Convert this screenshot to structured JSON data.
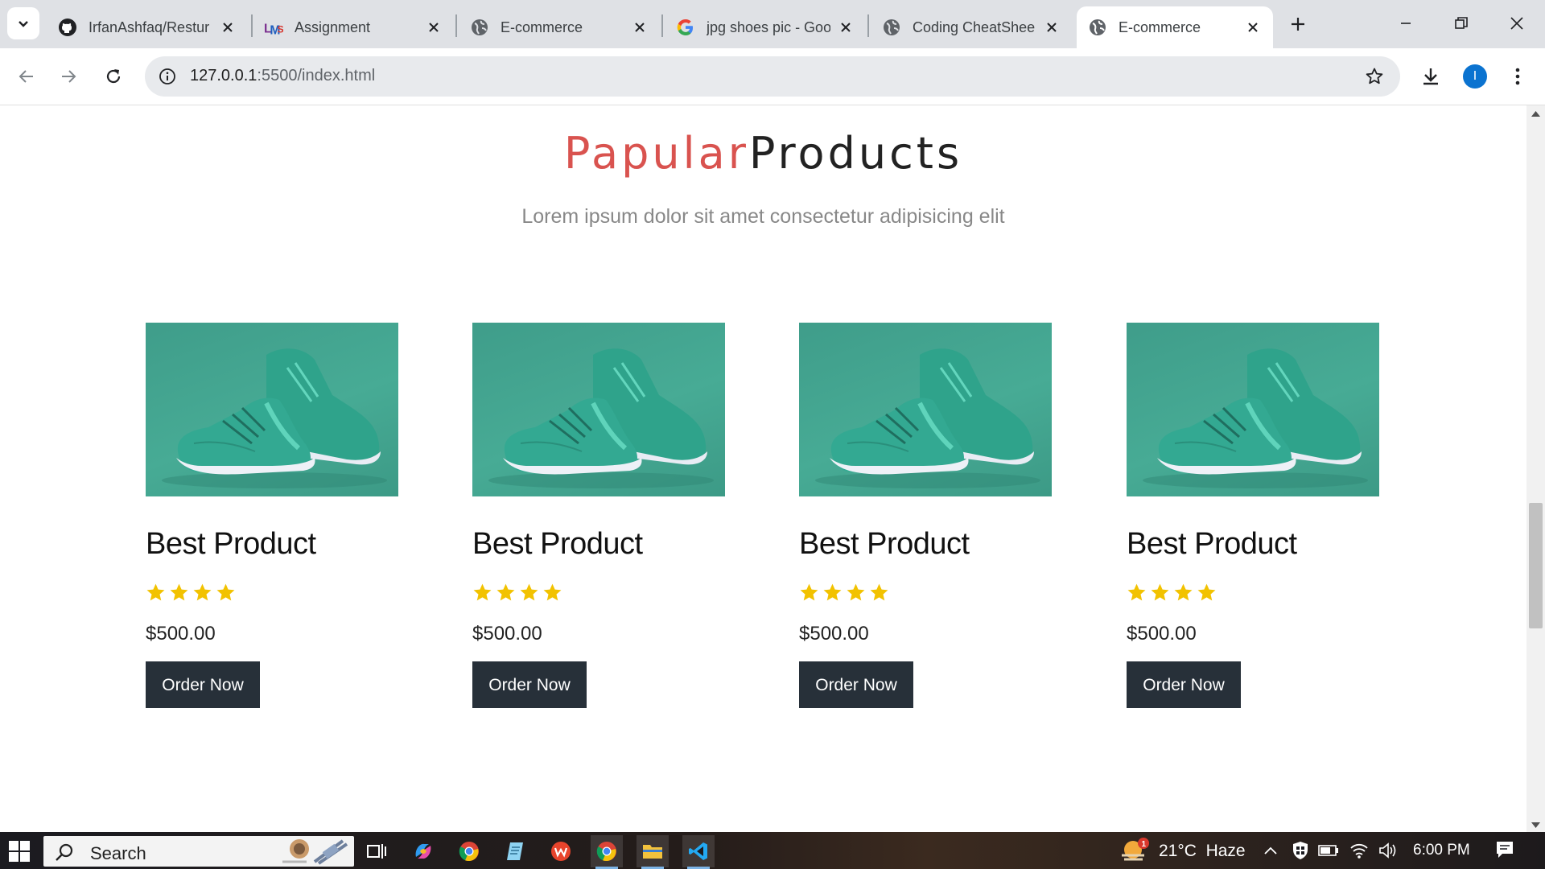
{
  "browser": {
    "tabs": [
      {
        "title": "IrfanAshfaq/Restur",
        "favicon": "github-icon",
        "active": false
      },
      {
        "title": "Assignment",
        "favicon": "lms-icon",
        "active": false
      },
      {
        "title": "E-commerce",
        "favicon": "globe-icon",
        "active": false
      },
      {
        "title": "jpg shoes pic - Goo",
        "favicon": "google-icon",
        "active": false
      },
      {
        "title": "Coding CheatShee",
        "favicon": "globe-icon",
        "active": false
      },
      {
        "title": "E-commerce",
        "favicon": "globe-icon",
        "active": true
      }
    ],
    "url_host": "127.0.0.1",
    "url_rest": ":5500/index.html",
    "profile_initial": "I",
    "accent": "#0b73d0"
  },
  "section": {
    "title_accent": "Papular",
    "title_rest": "Products",
    "subtitle": "Lorem ipsum dolor sit amet consectetur adipisicing elit",
    "accent_color": "#d9534f"
  },
  "products": [
    {
      "name": "Best Product",
      "rating": 4,
      "price": "$500.00",
      "button": "Order Now"
    },
    {
      "name": "Best Product",
      "rating": 4,
      "price": "$500.00",
      "button": "Order Now"
    },
    {
      "name": "Best Product",
      "rating": 4,
      "price": "$500.00",
      "button": "Order Now"
    },
    {
      "name": "Best Product",
      "rating": 4,
      "price": "$500.00",
      "button": "Order Now"
    }
  ],
  "taskbar": {
    "search_placeholder": "Search",
    "weather": "21°C  Haze",
    "weather_badge": "1",
    "time": "6:00 PM"
  }
}
